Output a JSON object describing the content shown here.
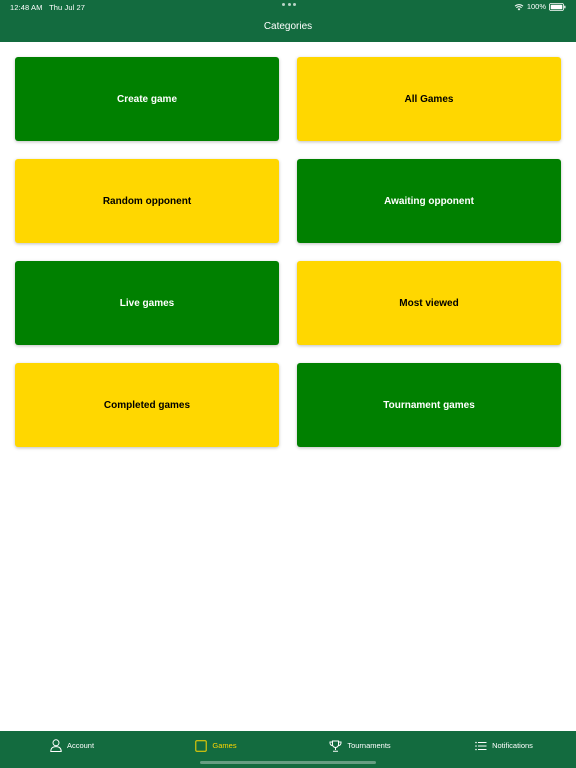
{
  "status_bar": {
    "time": "12:48 AM",
    "date": "Thu Jul 27",
    "battery": "100%"
  },
  "nav": {
    "title": "Categories"
  },
  "colors": {
    "header": "#136b3f",
    "green_tile": "#008000",
    "yellow_tile": "#ffd700",
    "active_tab": "#ffd700"
  },
  "categories": [
    {
      "label": "Create game",
      "color": "green"
    },
    {
      "label": "All Games",
      "color": "yellow"
    },
    {
      "label": "Random opponent",
      "color": "yellow"
    },
    {
      "label": "Awaiting opponent",
      "color": "green"
    },
    {
      "label": "Live games",
      "color": "green"
    },
    {
      "label": "Most viewed",
      "color": "yellow"
    },
    {
      "label": "Completed games",
      "color": "yellow"
    },
    {
      "label": "Tournament games",
      "color": "green"
    }
  ],
  "tabs": [
    {
      "label": "Account",
      "icon": "person-icon",
      "active": false
    },
    {
      "label": "Games",
      "icon": "square-icon",
      "active": true
    },
    {
      "label": "Tournaments",
      "icon": "trophy-icon",
      "active": false
    },
    {
      "label": "Notifications",
      "icon": "list-icon",
      "active": false
    }
  ]
}
